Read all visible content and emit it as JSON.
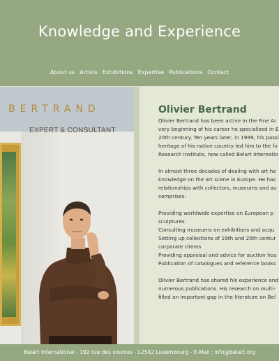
{
  "header": {
    "title": "Knowledge and Experience",
    "nav": [
      "About us",
      "Artists",
      "Exhibitions",
      "Expertise",
      "Publications",
      "Contact"
    ]
  },
  "photo": {
    "brand_name": "BERTRAND",
    "brand_sub": "EXPERT & CONSULTANT"
  },
  "content": {
    "title": "Olivier Bertrand",
    "para1": [
      "Olivier Bertrand has been active in the Fine Ar",
      "very beginning of his career he specialised in E",
      "20th century. Ten years later, in 1999, his passio",
      "heritage of his native country led him to the fo",
      "Research institute, now called Belart Internatio"
    ],
    "para2": [
      "In almost three decades of dealing with art he",
      "knowledge on the art scene in Europe. He has",
      "relationships with collectors, museums and au",
      "comprises:"
    ],
    "para3": [
      "Providing worldwide expertise on European p",
      "sculptures",
      "Consulting museums on exhibitions and acqu",
      "Setting up collections of 19th and 20th centur",
      "corporate clients",
      "Providing appraisal and advice for auction hou",
      "Publication of catalogues and reference books"
    ],
    "para4": [
      "Olivier Bertrand has shared his experience and",
      "numerous publications. His research on multi-",
      "filled an important gap in the literature on Bel"
    ]
  },
  "footer": {
    "text": "Belart International - 192 rue des sources - L2542 Luxembourg - E-Mail : info@belart.org"
  },
  "colors": {
    "header_bg": "#95a882",
    "content_bg": "#e3e8d7",
    "title_green": "#4d6b47",
    "brand_gold": "#b5893e"
  }
}
